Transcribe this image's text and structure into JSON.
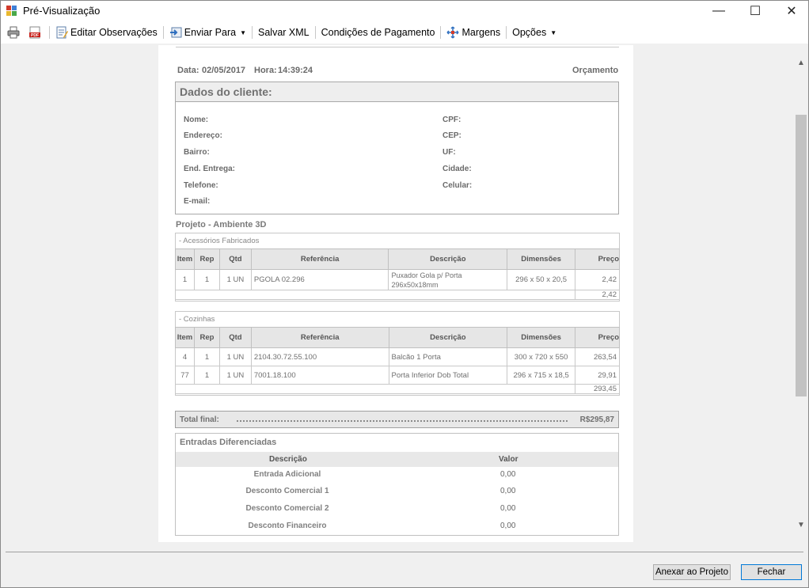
{
  "window": {
    "title": "Pré-Visualização",
    "minimize": "—",
    "maximize": "☐",
    "close": "✕"
  },
  "toolbar": {
    "print_icon": "printer-icon",
    "pdf_icon": "pdf-icon",
    "pdf_text": "PDF",
    "edit_notes": "Editar Observações",
    "send_to": "Enviar Para",
    "save_xml": "Salvar XML",
    "payment_terms": "Condições de Pagamento",
    "margins": "Margens",
    "options": "Opções"
  },
  "document": {
    "date_label": "Data:",
    "date": "02/05/2017",
    "time_label": "Hora:",
    "time": "14:39:24",
    "doc_type": "Orçamento",
    "client": {
      "header": "Dados do cliente:",
      "left_fields": [
        "Nome:",
        "Endereço:",
        "Bairro:",
        "End. Entrega:",
        "Telefone:",
        "E-mail:"
      ],
      "right_fields": [
        "CPF:",
        "CEP:",
        "UF:",
        "Cidade:",
        "Celular:"
      ]
    },
    "project_title": "Projeto - Ambiente 3D",
    "columns": [
      "Item",
      "Rep",
      "Qtd",
      "Referência",
      "Descrição",
      "Dimensões",
      "Preço"
    ],
    "groups": [
      {
        "title": "- Acessórios Fabricados",
        "rows": [
          {
            "item": "1",
            "rep": "1",
            "qtd": "1 UN",
            "ref": "PGOLA 02.296",
            "desc1": "Puxador Gola p/ Porta",
            "desc2": "296x50x18mm",
            "dim": "296 x 50 x 20,5",
            "price": "2,42"
          }
        ],
        "subtotal": "2,42"
      },
      {
        "title": "- Cozinhas",
        "rows": [
          {
            "item": "4",
            "rep": "1",
            "qtd": "1 UN",
            "ref": "2104.30.72.55.100",
            "desc1": "Balcão 1 Porta",
            "desc2": "",
            "dim": "300 x 720 x 550",
            "price": "263,54"
          },
          {
            "item": "77",
            "rep": "1",
            "qtd": "1 UN",
            "ref": "7001.18.100",
            "desc1": "Porta Inferior Dob Total",
            "desc2": "",
            "dim": "296 x 715 x 18,5",
            "price": "29,91"
          }
        ],
        "subtotal": "293,45"
      }
    ],
    "total_label": "Total final:",
    "total_value": "R$295,87",
    "entradas": {
      "title": "Entradas Diferenciadas",
      "col_desc": "Descrição",
      "col_value": "Valor",
      "rows": [
        {
          "desc": "Entrada Adicional",
          "value": "0,00"
        },
        {
          "desc": "Desconto Comercial 1",
          "value": "0,00"
        },
        {
          "desc": "Desconto Comercial 2",
          "value": "0,00"
        },
        {
          "desc": "Desconto Financeiro",
          "value": "0,00"
        }
      ]
    }
  },
  "buttons": {
    "attach": "Anexar ao Projeto",
    "close": "Fechar"
  },
  "colors": {
    "accent": "#0078d7",
    "header_gray": "#e6e6e6"
  }
}
